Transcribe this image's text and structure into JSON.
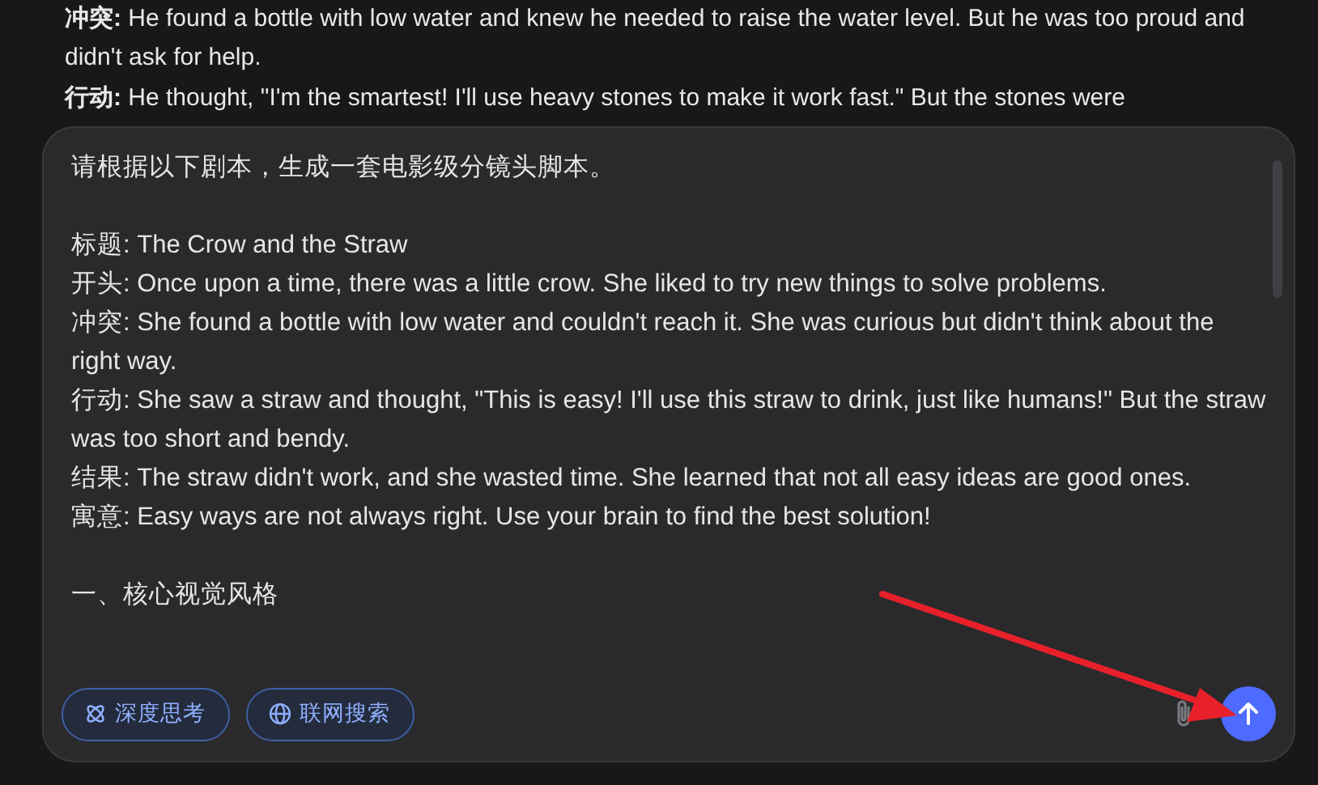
{
  "chat_text": [
    {
      "text": "**冲突:** He found a bottle with low water and knew he needed to raise the water level. But he was too proud and didn't ask for help."
    },
    {
      "text": "**行动:** He thought, \"I'm the smartest! I'll use heavy stones to make it work fast.\" But the stones were"
    }
  ],
  "composer": {
    "paragraphs": [
      [
        "请根据以下剧本，生成一套电影级分镜头脚本。"
      ],
      [
        "标题: The Crow and the Straw",
        "开头: Once upon a time, there was a little crow. She liked to try new things to solve problems.",
        "冲突: She found a bottle with low water and couldn't reach it. She was curious but didn't think about the right way.",
        "行动: She saw a straw and thought, \"This is easy! I'll use this straw to drink, just like humans!\" But the straw was too short and bendy.",
        "结果: The straw didn't work, and she wasted time. She learned that not all easy ideas are good ones.",
        "寓意: Easy ways are not always right. Use your brain to find the best solution!"
      ],
      [
        "一、核心视觉风格"
      ]
    ],
    "buttons": [
      {
        "label": "深度思考"
      },
      {
        "label": "联网搜索"
      }
    ]
  }
}
